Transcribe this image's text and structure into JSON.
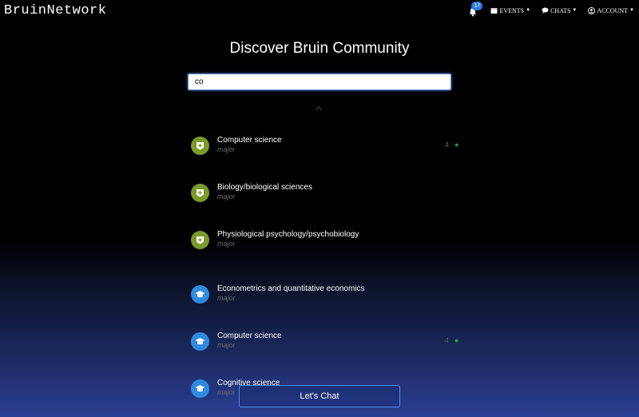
{
  "brand": "BruinNetwork",
  "nav": {
    "notification_count": "17",
    "events_label": "EVENTS",
    "chats_label": "CHATS",
    "account_label": "ACCOUNT"
  },
  "page_title": "Discover Bruin Community",
  "search": {
    "value": "co"
  },
  "results": [
    {
      "name": "Computer science",
      "type": "major",
      "count": "4",
      "icon": "plus-badge-icon"
    },
    {
      "name": "Biology/biological sciences",
      "type": "major",
      "count": "",
      "icon": "plus-badge-icon"
    },
    {
      "name": "Physiological psychology/psychobiology",
      "type": "major",
      "count": "",
      "icon": "plus-badge-icon"
    },
    {
      "name": "Econometrics and quantitative economics",
      "type": "major",
      "count": "",
      "icon": "graduation-cap-icon"
    },
    {
      "name": "Computer science",
      "type": "major",
      "count": "4",
      "icon": "graduation-cap-icon"
    },
    {
      "name": "Cognitive science",
      "type": "major",
      "count": "",
      "icon": "graduation-cap-icon"
    }
  ],
  "chat_button": "Let's Chat"
}
